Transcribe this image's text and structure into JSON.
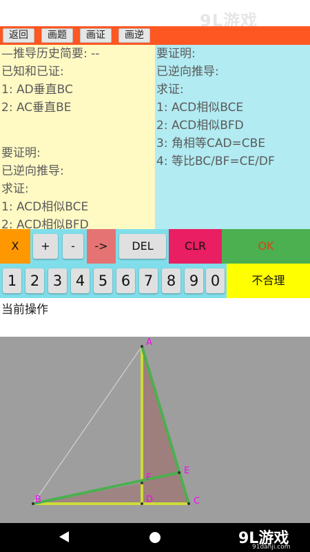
{
  "toolbar": {
    "buttons": [
      "返回",
      "画题",
      "画证",
      "画逆"
    ]
  },
  "left_panel": {
    "lines": [
      "—推导历史简要: --",
      "已知和已证:",
      "1: AD垂直BC",
      "2: AC垂直BE",
      "",
      "要证明:",
      "已逆向推导:",
      "求证:",
      "1: ACD相似BCE",
      "2: ACD相似BFD"
    ]
  },
  "right_panel": {
    "lines": [
      "要证明:",
      "已逆向推导:",
      "求证:",
      "1: ACD相似BCE",
      "2: ACD相似BFD",
      "3: 角相等CAD=CBE",
      "4: 等比BC/BF=CE/DF"
    ]
  },
  "keypad": {
    "row1": [
      "X",
      "+",
      "-",
      "->",
      "DEL",
      "CLR",
      "OK"
    ],
    "digits": [
      "1",
      "2",
      "3",
      "4",
      "5",
      "6",
      "7",
      "8",
      "9",
      "0"
    ],
    "unreasonable": "不合理"
  },
  "current_operation": "当前操作",
  "figure": {
    "points": [
      "A",
      "B",
      "C",
      "D",
      "E",
      "F"
    ]
  },
  "watermark": {
    "logo": "9L游戏",
    "site": "91danji.com"
  },
  "colors": {
    "toolbar": "#ff5722",
    "left_panel": "#fff9c4",
    "right_panel": "#b2ebf2",
    "key_x": "#ff9800",
    "key_arrow": "#e57373",
    "key_clr": "#e91e63",
    "key_ok": "#4caf50",
    "key_unreasonable": "#ffff00"
  }
}
